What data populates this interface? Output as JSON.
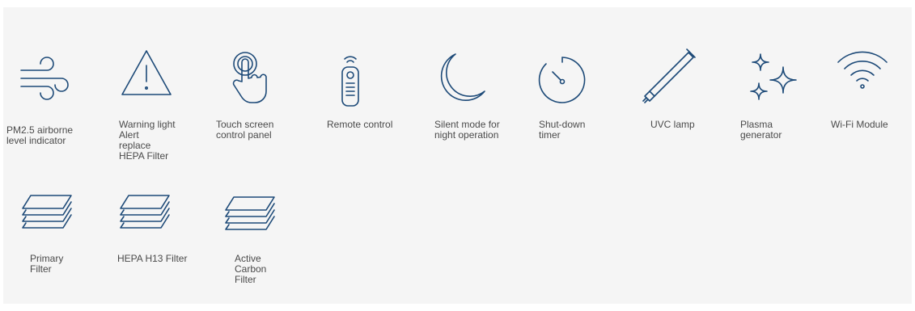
{
  "features": [
    {
      "label": "PM2.5 airborne\nlevel indicator",
      "icon": "wind-icon"
    },
    {
      "label": "Warning light\nAlert\nreplace\nHEPA Filter",
      "icon": "warning-triangle-icon"
    },
    {
      "label": "Touch screen\ncontrol panel",
      "icon": "touch-finger-icon"
    },
    {
      "label": "Remote control",
      "icon": "remote-control-icon"
    },
    {
      "label": "Silent mode for\nnight operation",
      "icon": "crescent-moon-icon"
    },
    {
      "label": "Shut-down\ntimer",
      "icon": "timer-icon"
    },
    {
      "label": "UVC lamp",
      "icon": "uvc-lamp-icon"
    },
    {
      "label": "Plasma\ngenerator",
      "icon": "sparkle-icon"
    },
    {
      "label": "Wi-Fi Module",
      "icon": "wifi-icon"
    },
    {
      "label": "Primary\nFilter",
      "icon": "filter-layers-icon"
    },
    {
      "label": "HEPA H13 Filter",
      "icon": "filter-layers-icon"
    },
    {
      "label": "Active\nCarbon\nFilter",
      "icon": "filter-layers-icon"
    }
  ],
  "colors": {
    "icon_stroke": "#1d4a78",
    "panel_bg": "#f5f5f5",
    "text": "#4a4a4a"
  }
}
